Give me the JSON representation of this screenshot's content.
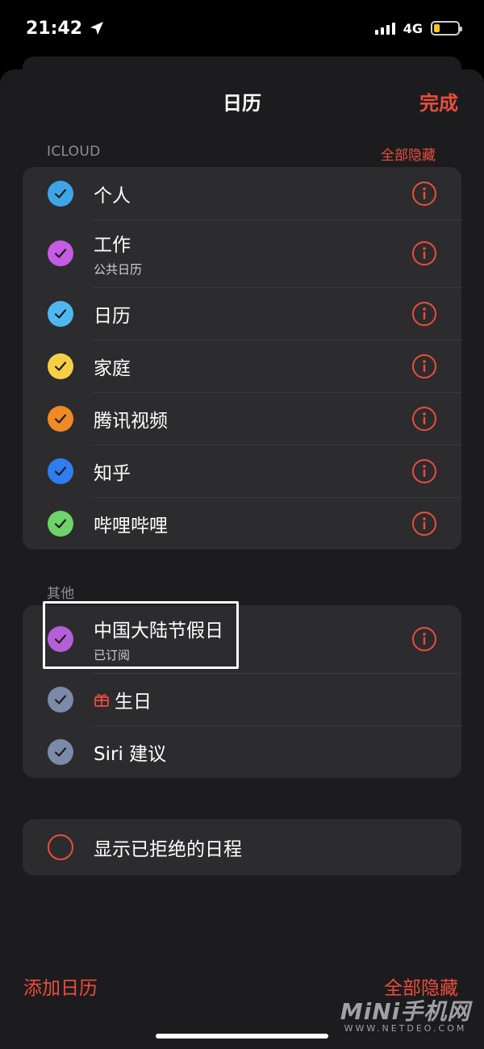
{
  "status_bar": {
    "time": "21:42",
    "network": "4G",
    "battery_level": 0.25,
    "battery_color": "#f5c518"
  },
  "nav": {
    "title": "日历",
    "done_label": "完成"
  },
  "icloud": {
    "header": "ICLOUD",
    "action": "全部隐藏",
    "items": [
      {
        "title": "个人",
        "subtitle": "",
        "color": "#3ea6e8"
      },
      {
        "title": "工作",
        "subtitle": "公共日历",
        "color": "#c55ce3"
      },
      {
        "title": "日历",
        "subtitle": "",
        "color": "#4fb8f0"
      },
      {
        "title": "家庭",
        "subtitle": "",
        "color": "#f7cf46"
      },
      {
        "title": "腾讯视频",
        "subtitle": "",
        "color": "#f08a24"
      },
      {
        "title": "知乎",
        "subtitle": "",
        "color": "#2f7df0"
      },
      {
        "title": "哔哩哔哩",
        "subtitle": "",
        "color": "#6ed46a"
      }
    ]
  },
  "other": {
    "header": "其他",
    "items": [
      {
        "title": "中国大陆节假日",
        "subtitle": "已订阅",
        "color": "#b65fd8"
      },
      {
        "title": "生日",
        "subtitle": "",
        "color": "#7a8aa8"
      },
      {
        "title": "Siri 建议",
        "subtitle": "",
        "color": "#7a8aa8"
      }
    ]
  },
  "declined": {
    "label": "显示已拒绝的日程"
  },
  "bottom": {
    "add_label": "添加日历",
    "hide_all_label": "全部隐藏"
  },
  "watermark": {
    "main": "MiNi手机网",
    "sub": "WWW.NETDEO.COM"
  },
  "colors": {
    "accent": "#eb4d3d",
    "background": "#000000",
    "sheet": "#1c1c1e",
    "group": "#2c2c2e"
  }
}
